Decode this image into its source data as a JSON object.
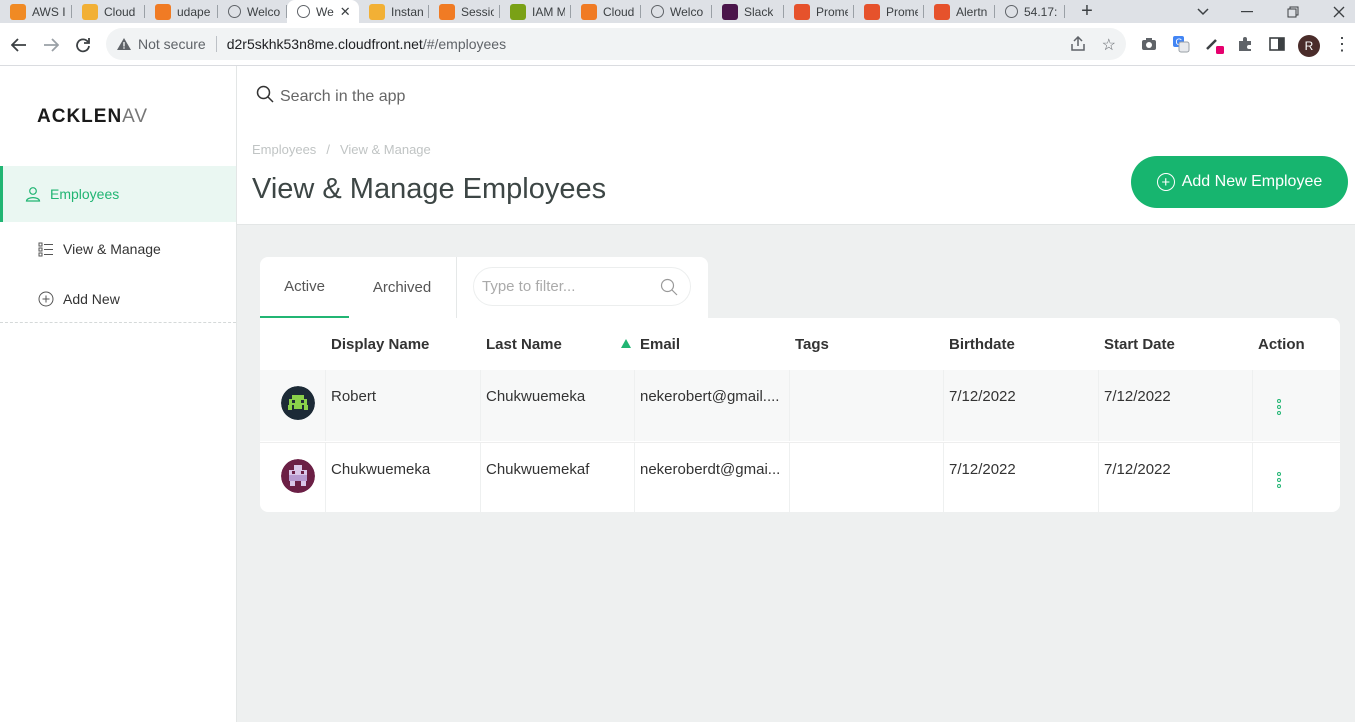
{
  "browser": {
    "tabs": [
      {
        "label": "AWS I",
        "icon": "aws-cube-icon",
        "color": "#f08a24"
      },
      {
        "label": "Cloud",
        "icon": "cloud-cube-icon",
        "color": "#f2b035"
      },
      {
        "label": "udape",
        "icon": "aws-cube-icon",
        "color": "#f07b24"
      },
      {
        "label": "Welco",
        "icon": "globe-icon",
        "color": "#5f6368"
      },
      {
        "label": "We",
        "icon": "globe-icon",
        "color": "#5f6368"
      },
      {
        "label": "Instan",
        "icon": "cloud-cube-icon",
        "color": "#f2b035"
      },
      {
        "label": "Sessio",
        "icon": "aws-cube-icon",
        "color": "#f07b24"
      },
      {
        "label": "IAM M",
        "icon": "iam-key-icon",
        "color": "#7aa116"
      },
      {
        "label": "Cloud",
        "icon": "aws-cube-icon",
        "color": "#f07b24"
      },
      {
        "label": "Welco",
        "icon": "globe-icon",
        "color": "#5f6368"
      },
      {
        "label": "Slack",
        "icon": "slack-icon",
        "color": "#4a154b"
      },
      {
        "label": "Prome",
        "icon": "prometheus-icon",
        "color": "#e6522c"
      },
      {
        "label": "Prome",
        "icon": "prometheus-icon",
        "color": "#e6522c"
      },
      {
        "label": "Alertn",
        "icon": "prometheus-icon",
        "color": "#e6522c"
      },
      {
        "label": "54.17:",
        "icon": "globe-icon",
        "color": "#5f6368"
      }
    ],
    "not_secure": "Not secure",
    "url_host": "d2r5skhk53n8me.cloudfront.net",
    "url_path": "/#/employees",
    "profile_initial": "R"
  },
  "app": {
    "logo_main": "ACKLEN",
    "logo_tail": "AV",
    "search_placeholder": "Search in the app",
    "nav": {
      "employees": "Employees",
      "view_manage": "View & Manage",
      "add_new": "Add New"
    },
    "breadcrumb": [
      "Employees",
      "View & Manage"
    ],
    "breadcrumb_sep": "/",
    "title": "View & Manage Employees",
    "add_button": "Add New Employee",
    "tabs": {
      "active": "Active",
      "archived": "Archived"
    },
    "filter_placeholder": "Type to filter...",
    "columns": [
      "Display Name",
      "Last Name",
      "Email",
      "Tags",
      "Birthdate",
      "Start Date",
      "Action"
    ],
    "rows": [
      {
        "display_name": "Robert",
        "last_name": "Chukwuemeka",
        "email": "nekerobert@gmail....",
        "tags": "",
        "birthdate": "7/12/2022",
        "start_date": "7/12/2022"
      },
      {
        "display_name": "Chukwuemeka",
        "last_name": "Chukwuemekaf",
        "email": "nekeroberdt@gmai...",
        "tags": "",
        "birthdate": "7/12/2022",
        "start_date": "7/12/2022"
      }
    ],
    "colors": {
      "accent": "#17b56f",
      "background": "#eef0f0"
    }
  }
}
